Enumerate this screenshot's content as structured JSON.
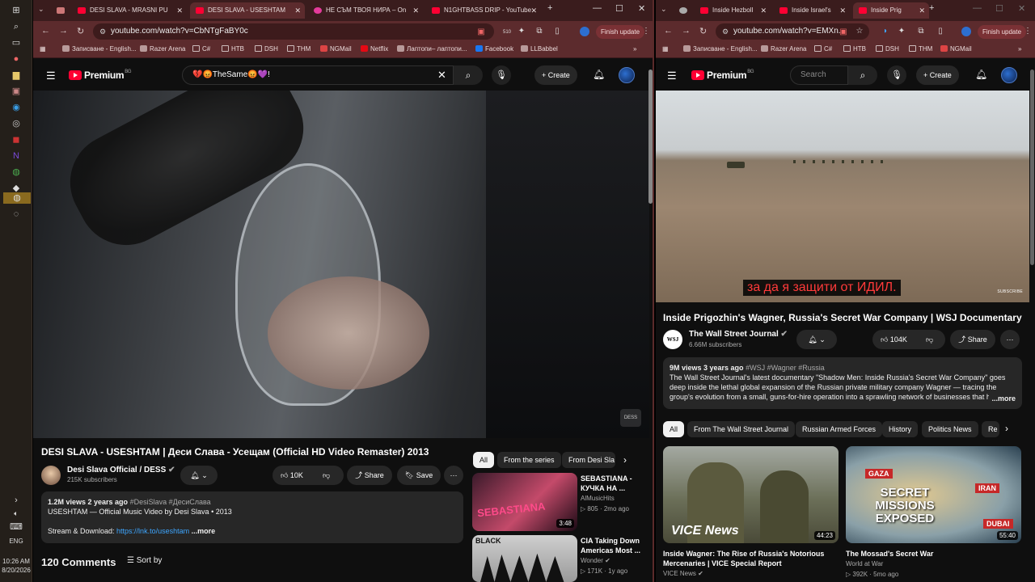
{
  "taskbar": {
    "lang": "ENG",
    "time": "10:26 AM",
    "date": "8/20/2026"
  },
  "left": {
    "tabs": [
      {
        "label": "DESI SLAVA - MRASNI PU"
      },
      {
        "label": "DESI SLAVA - USESHTAM"
      },
      {
        "label": "НЕ СЪМ ТВОЯ НИРА – On"
      },
      {
        "label": "N1GHTBASS DRIP - YouTube"
      }
    ],
    "url": "youtube.com/watch?v=CbNTgFaBY0c",
    "badge": "510",
    "finish_update": "Finish update",
    "bookmarks": [
      "Записване - English...",
      "Razer Arena",
      "C#",
      "HTB",
      "DSH",
      "THM",
      "NGMail",
      "Netflix",
      "Лаптопи– лаптопи...",
      "Facebook",
      "LLBabbel"
    ],
    "logo": "Premium",
    "logo_region": "BG",
    "search_value": "💔😡TheSame😡💜!",
    "create": "Create",
    "video_title": "DESI SLAVA - USESHTAM | Деси Слава - Усещам (Official HD Video Remaster) 2013",
    "channel_name": "Desi Slava Official / DESS",
    "channel_subs": "215K subscribers",
    "likes": "10K",
    "share": "Share",
    "save": "Save",
    "desc_meta": "1.2M views  2 years ago",
    "desc_tags": "#DesiSlava #ДесиСлава",
    "desc_line1": "USESHTAM — Official Music Video by Desi Slava • 2013",
    "desc_stream": "Stream & Download: ",
    "desc_link": "https://lnk.to/useshtam",
    "desc_more": "...more",
    "comments": "120 Comments",
    "sort_by": "Sort by",
    "chips": [
      "All",
      "From the series",
      "From Desi Sla"
    ],
    "related": [
      {
        "title": "SEBASTIANA - КУЧКА НА ...",
        "channel": "AlMusicHits",
        "stats": "▷ 805 · 2mo ago",
        "duration": "3:48",
        "thumb_text": "SEBASTIANA"
      },
      {
        "title": "CIA Taking Down Americas Most ...",
        "channel": "Wonder",
        "stats": "▷ 171K · 1y ago",
        "duration": "",
        "thumb_text": "BLACK"
      }
    ]
  },
  "right": {
    "tabs": [
      {
        "label": "Inside Hezboll"
      },
      {
        "label": "Inside Israel's"
      },
      {
        "label": "Inside Prig"
      }
    ],
    "url": "youtube.com/watch?v=EMXn...",
    "finish_update": "Finish update",
    "bookmarks": [
      "Записване - English...",
      "Razer Arena",
      "C#",
      "HTB",
      "DSH",
      "THM",
      "NGMail"
    ],
    "logo": "Premium",
    "logo_region": "BG",
    "search_placeholder": "Search",
    "create": "Create",
    "subtitle": "за да я защити от ИДИЛ.",
    "subscribe_mark": "SUBSCRIBE",
    "video_title": "Inside Prigozhin's Wagner, Russia's Secret War Company | WSJ Documentary",
    "channel_name": "The Wall Street Journal",
    "channel_subs": "6.66M subscribers",
    "channel_logo": "WSJ",
    "likes": "104K",
    "share": "Share",
    "desc_meta": "9M views  3 years ago",
    "desc_tags": "#WSJ #Wagner #Russia",
    "desc_text": "The Wall Street Journal's latest documentary \"Shadow Men: Inside Russia's Secret War Company\" goes deep inside the lethal global expansion of the Russian private military company Wagner — tracing the group's evolution from a small, guns-for-hire operation into a sprawling network of businesses that has been a",
    "desc_more": "...more",
    "chips": [
      "All",
      "From The Wall Street Journal",
      "Russian Armed Forces",
      "History",
      "Politics News",
      "Re"
    ],
    "videos": [
      {
        "title": "Inside Wagner: The Rise of Russia's Notorious Mercenaries | VICE Special Report",
        "channel": "VICE News",
        "duration": "44:23",
        "thumb_text": "VICE News"
      },
      {
        "title": "The Mossad's Secret War",
        "channel": "World at War",
        "stats": "▷ 392K · 5mo ago",
        "duration": "55:40",
        "thumb_text": "SECRET MISSIONS EXPOSED",
        "tag1": "GAZA",
        "tag2": "IRAN",
        "tag3": "DUBAI"
      }
    ]
  }
}
